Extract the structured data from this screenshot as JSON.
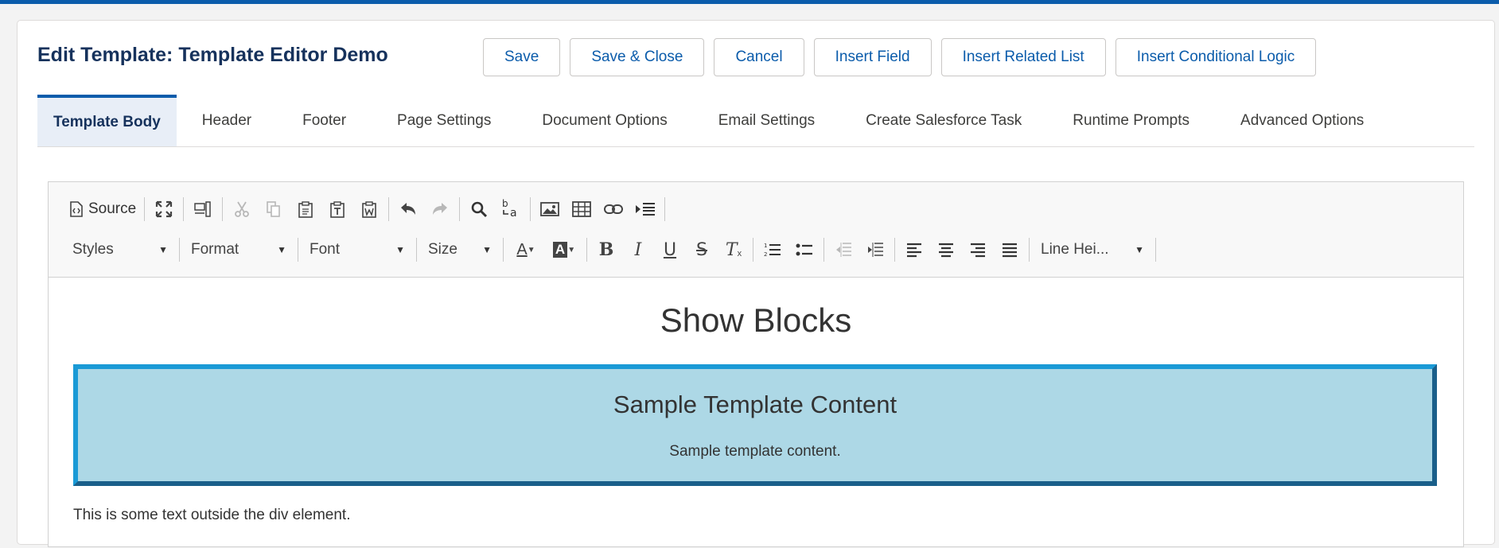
{
  "page": {
    "title": "Edit Template: Template Editor Demo"
  },
  "actions": {
    "save": "Save",
    "save_close": "Save & Close",
    "cancel": "Cancel",
    "insert_field": "Insert Field",
    "insert_related_list": "Insert Related List",
    "insert_conditional_logic": "Insert Conditional Logic"
  },
  "tabs": [
    {
      "label": "Template Body",
      "active": true
    },
    {
      "label": "Header"
    },
    {
      "label": "Footer"
    },
    {
      "label": "Page Settings"
    },
    {
      "label": "Document Options"
    },
    {
      "label": "Email Settings"
    },
    {
      "label": "Create Salesforce Task"
    },
    {
      "label": "Runtime Prompts"
    },
    {
      "label": "Advanced Options"
    }
  ],
  "toolbar": {
    "source_label": "Source",
    "styles": "Styles",
    "format": "Format",
    "font": "Font",
    "size": "Size",
    "line_height": "Line Hei...",
    "icons": {
      "source": "source-icon",
      "maximize": "maximize-icon",
      "show_blocks": "show-blocks-icon",
      "cut": "cut-icon",
      "copy": "copy-icon",
      "paste": "paste-icon",
      "paste_text": "paste-text-icon",
      "paste_word": "paste-word-icon",
      "undo": "undo-icon",
      "redo": "redo-icon",
      "find": "find-icon",
      "replace": "replace-icon",
      "image": "image-icon",
      "table": "table-icon",
      "link": "link-icon",
      "page_break": "page-break-icon"
    },
    "bold_glyph": "B",
    "italic_glyph": "I",
    "underline_glyph": "U",
    "strike_glyph": "S",
    "text_color_glyph": "A",
    "bg_color_glyph": "A",
    "remove_format_glyph": "T"
  },
  "content": {
    "heading": "Show Blocks",
    "block_heading": "Sample Template Content",
    "block_text": "Sample template content.",
    "outside_text": "This is some text outside the div element."
  },
  "colors": {
    "brand": "#0b5cab",
    "title": "#16325c",
    "block_bg": "#add8e6",
    "block_border": "#1a9ad6"
  }
}
